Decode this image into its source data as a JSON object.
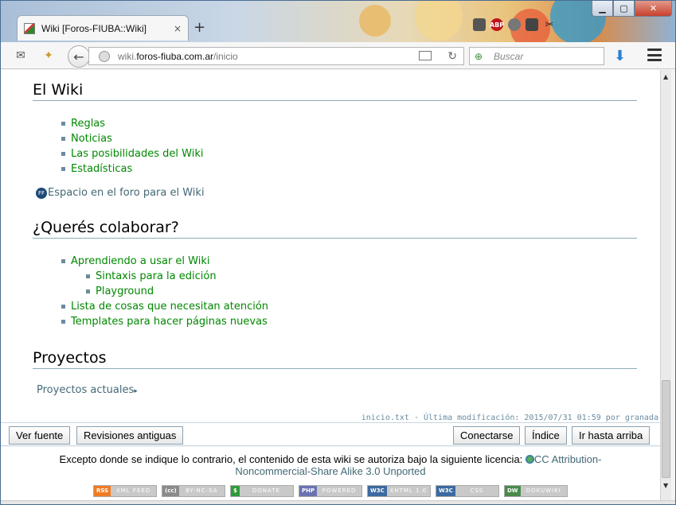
{
  "browser": {
    "tab_title": "Wiki [Foros-FIUBA::Wiki]",
    "tab_close": "×",
    "new_tab": "+",
    "url_domain_prefix": "wiki.",
    "url_domain": "foros-fiuba.com.ar",
    "url_path": "/inicio",
    "search_placeholder": "Buscar",
    "window_buttons": {
      "minimize": "▁",
      "maximize": "▢",
      "close": "✕"
    },
    "extensions": [
      "mail-icon",
      "addon-icon",
      "plugin-icon",
      "adblock-icon",
      "gear-icon",
      "notes-icon",
      "scissors-icon"
    ],
    "adblock_label": "ABP"
  },
  "sections": {
    "wiki": {
      "title": "El Wiki",
      "items": [
        "Reglas",
        "Noticias",
        "Las posibilidades del Wiki",
        "Estadísticas"
      ],
      "forum_link": "Espacio en el foro para el Wiki",
      "forum_icon_text": "FF"
    },
    "collaborate": {
      "title": "¿Querés colaborar?",
      "item_learn": "Aprendiendo a usar el Wiki",
      "sub_items": [
        "Sintaxis para la edición",
        "Playground"
      ],
      "item_attention": "Lista de cosas que necesitan atención",
      "item_templates": "Templates para hacer páginas nuevas"
    },
    "projects": {
      "title": "Proyectos",
      "link": "Proyectos actuales",
      "link_arrow": "▸"
    }
  },
  "meta": "inicio.txt · Última modificación: 2015/07/31 01:59 por granada",
  "buttons": {
    "view_source": "Ver fuente",
    "old_revisions": "Revisiones antiguas",
    "login": "Conectarse",
    "index": "Índice",
    "top": "Ir hasta arriba"
  },
  "license": {
    "text": "Excepto donde se indique lo contrario, el contenido de esta wiki se autoriza bajo la siguiente licencia:",
    "link_part1": "CC Attribution-",
    "link_part2": "Noncommercial-Share Alike 3.0 Unported"
  },
  "badges": [
    {
      "left": "RSS",
      "right": "XML FEED",
      "color": "#f07b22"
    },
    {
      "left": "(cc)",
      "right": "BY-NC-SA",
      "color": "#8a8a8a"
    },
    {
      "left": "$",
      "right": "DONATE",
      "color": "#2f9a3a"
    },
    {
      "left": "PHP",
      "right": "POWERED",
      "color": "#6a73b2"
    },
    {
      "left": "W3C",
      "right": "XHTML 1.0",
      "color": "#3b6aa0"
    },
    {
      "left": "W3C",
      "right": "CSS",
      "color": "#3b6aa0"
    },
    {
      "left": "DW",
      "right": "DOKUWIKI",
      "color": "#4a8a4a"
    }
  ]
}
